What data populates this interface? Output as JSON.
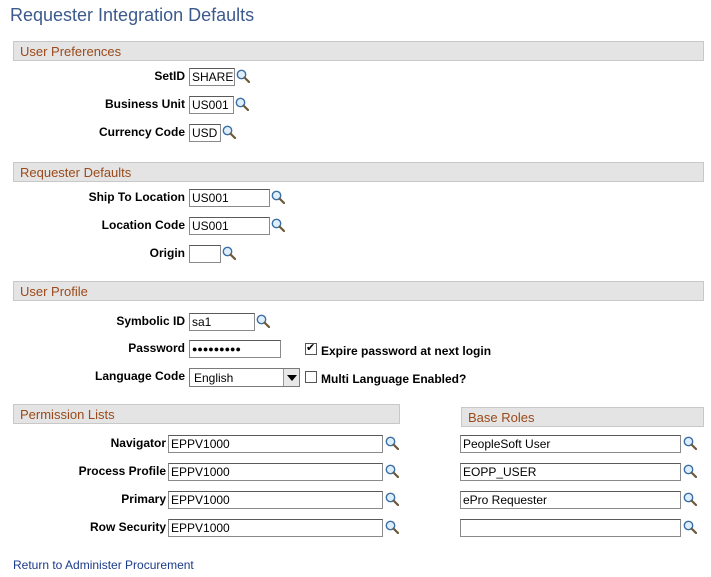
{
  "page": {
    "title": "Requester Integration Defaults"
  },
  "sections": {
    "user_preferences": "User Preferences",
    "requester_defaults": "Requester Defaults",
    "user_profile": "User Profile",
    "permission_lists": "Permission Lists",
    "base_roles": "Base Roles"
  },
  "user_preferences": {
    "setid": {
      "label": "SetID",
      "value": "SHARE"
    },
    "business_unit": {
      "label": "Business Unit",
      "value": "US001"
    },
    "currency_code": {
      "label": "Currency Code",
      "value": "USD"
    }
  },
  "requester_defaults": {
    "ship_to_location": {
      "label": "Ship To Location",
      "value": "US001"
    },
    "location_code": {
      "label": "Location Code",
      "value": "US001"
    },
    "origin": {
      "label": "Origin",
      "value": ""
    }
  },
  "user_profile": {
    "symbolic_id": {
      "label": "Symbolic ID",
      "value": "sa1"
    },
    "password": {
      "label": "Password",
      "value": "●●●●●●●●●"
    },
    "expire_password": {
      "label": "Expire password at next login",
      "checked": true
    },
    "language_code": {
      "label": "Language Code",
      "value": "English"
    },
    "multi_language": {
      "label": "Multi Language Enabled?",
      "checked": false
    }
  },
  "permission_lists": {
    "navigator": {
      "label": "Navigator",
      "value": "EPPV1000"
    },
    "process_profile": {
      "label": "Process Profile",
      "value": "EPPV1000"
    },
    "primary": {
      "label": "Primary",
      "value": "EPPV1000"
    },
    "row_security": {
      "label": "Row Security",
      "value": "EPPV1000"
    }
  },
  "base_roles": [
    "PeopleSoft User",
    "EOPP_USER",
    "ePro Requester",
    ""
  ],
  "links": {
    "return": "Return to Administer Procurement"
  },
  "icons": {
    "lookup": "magnifier-lookup-icon",
    "dropdown": "chevron-down-icon"
  }
}
